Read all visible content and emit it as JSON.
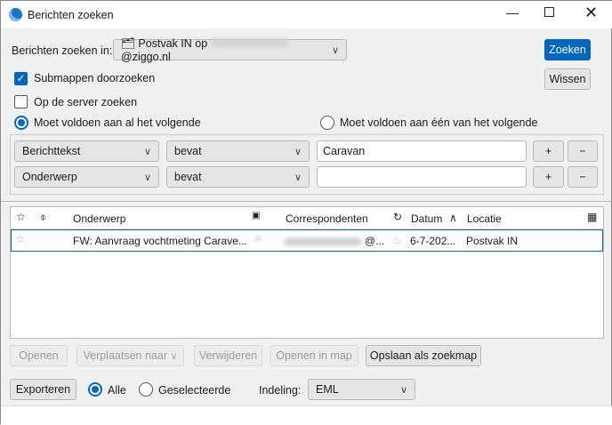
{
  "window": {
    "title": "Berichten zoeken"
  },
  "search_in": {
    "label": "Berichten zoeken in:",
    "folder_prefix": "Postvak IN op",
    "folder_suffix": "@ziggo.nl"
  },
  "buttons": {
    "search": "Zoeken",
    "clear": "Wissen",
    "open": "Openen",
    "move": "Verplaatsen naar",
    "delete": "Verwijderen",
    "open_in_folder": "Openen in map",
    "save_as_search_folder": "Opslaan als zoekmap",
    "export": "Exporteren"
  },
  "options": {
    "subfolders": "Submappen doorzoeken",
    "server": "Op de server zoeken",
    "match_all": "Moet voldoen aan al het volgende",
    "match_any": "Moet voldoen aan één van het volgende"
  },
  "criteria": [
    {
      "field": "Berichttekst",
      "operator": "bevat",
      "value": "Caravan"
    },
    {
      "field": "Onderwerp",
      "operator": "bevat",
      "value": ""
    }
  ],
  "criteria_buttons": {
    "add": "+",
    "remove": "−"
  },
  "table": {
    "columns": {
      "subject": "Onderwerp",
      "correspondents": "Correspondenten",
      "date": "Datum",
      "location": "Locatie"
    },
    "rows": [
      {
        "subject": "FW: Aanvraag vochtmeting Carave...",
        "correspondent_suffix": "@...",
        "date": "6-7-202...",
        "location": "Postvak IN"
      }
    ]
  },
  "export": {
    "all": "Alle",
    "selected": "Geselecteerde",
    "format_label": "Indeling:",
    "format": "EML"
  },
  "colors": {
    "accent": "#0067c0"
  }
}
